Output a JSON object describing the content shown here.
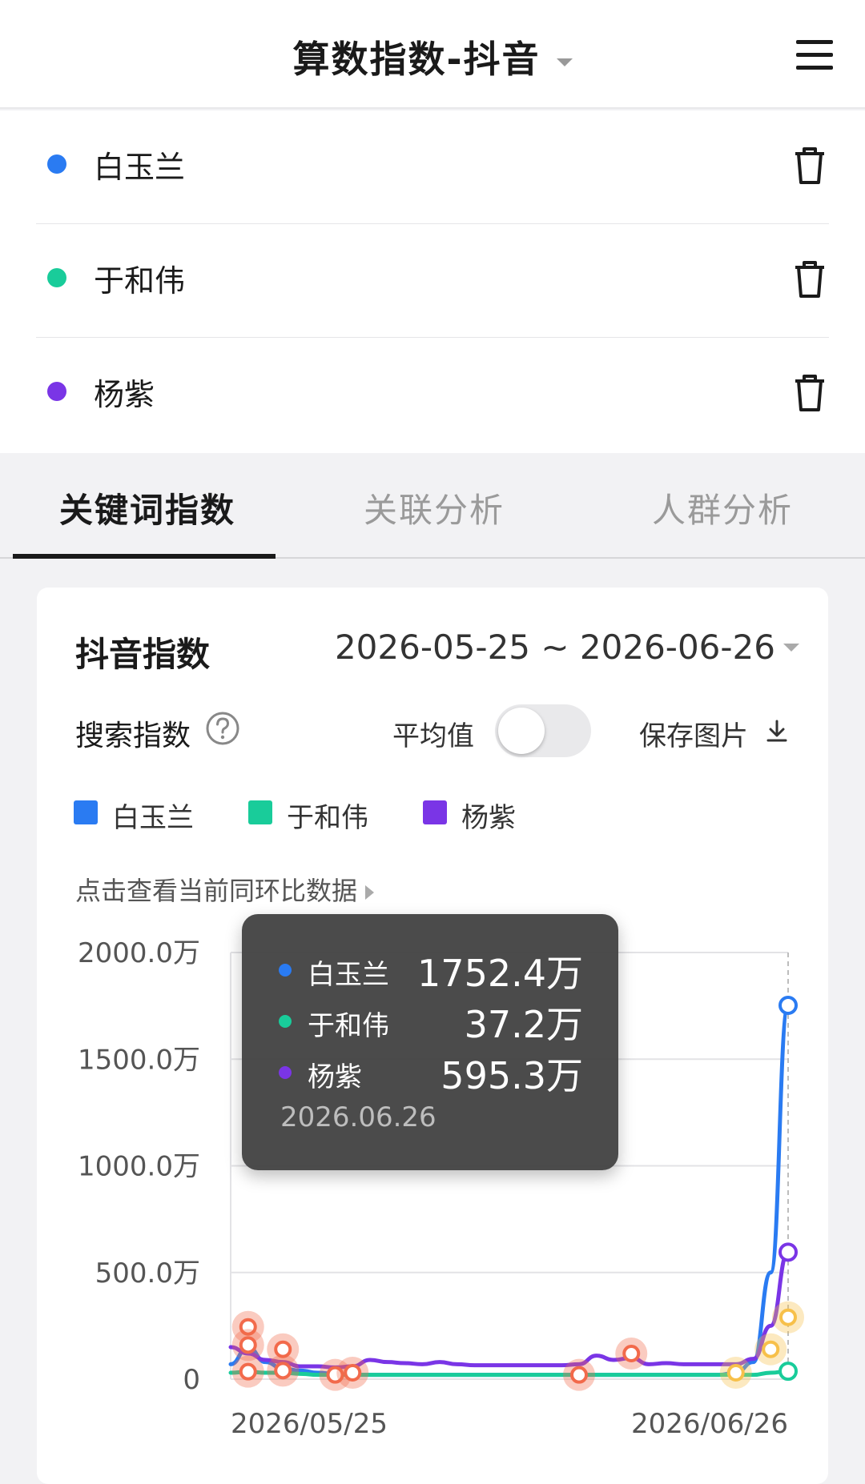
{
  "header": {
    "title": "算数指数-抖音"
  },
  "keywords": [
    {
      "label": "白玉兰",
      "color": "#2a7bf2"
    },
    {
      "label": "于和伟",
      "color": "#19cc9a"
    },
    {
      "label": "杨紫",
      "color": "#7a35e6"
    }
  ],
  "tabs": [
    {
      "label": "关键词指数",
      "active": true
    },
    {
      "label": "关联分析",
      "active": false
    },
    {
      "label": "人群分析",
      "active": false
    }
  ],
  "card": {
    "title": "抖音指数",
    "date_range": "2026-05-25 ~ 2026-06-26",
    "metric_label": "搜索指数",
    "average_label": "平均值",
    "average_enabled": false,
    "save_label": "保存图片",
    "compare_link": "点击查看当前同环比数据"
  },
  "tooltip": {
    "date": "2026.06.26",
    "items": [
      {
        "name": "白玉兰",
        "value": "1752.4万",
        "color": "#2a7bf2"
      },
      {
        "name": "于和伟",
        "value": "37.2万",
        "color": "#19cc9a"
      },
      {
        "name": "杨紫",
        "value": "595.3万",
        "color": "#7a35e6"
      }
    ]
  },
  "chart_data": {
    "type": "line",
    "x_tick_labels": [
      "2026/05/25",
      "2026/06/26"
    ],
    "y_tick_labels": [
      "0",
      "500.0万",
      "1000.0万",
      "1500.0万",
      "2000.0万"
    ],
    "ylim": [
      0,
      2000
    ],
    "y_unit": "万",
    "grid": true,
    "legend_position": "top-left",
    "x_points": 33,
    "series": [
      {
        "name": "白玉兰",
        "color": "#2a7bf2",
        "values": [
          70,
          150,
          80,
          50,
          40,
          30,
          25,
          20,
          20,
          20,
          20,
          20,
          20,
          20,
          20,
          20,
          20,
          20,
          20,
          20,
          20,
          20,
          20,
          20,
          20,
          20,
          20,
          20,
          20,
          30,
          80,
          500,
          1752.4
        ]
      },
      {
        "name": "于和伟",
        "color": "#19cc9a",
        "values": [
          30,
          35,
          30,
          30,
          25,
          20,
          20,
          20,
          20,
          20,
          20,
          20,
          20,
          20,
          20,
          20,
          20,
          20,
          20,
          20,
          20,
          20,
          20,
          20,
          20,
          20,
          20,
          20,
          20,
          20,
          20,
          30,
          37.2
        ]
      },
      {
        "name": "杨紫",
        "color": "#7a35e6",
        "values": [
          150,
          120,
          90,
          80,
          60,
          60,
          55,
          60,
          90,
          80,
          75,
          70,
          80,
          70,
          65,
          65,
          65,
          65,
          65,
          65,
          70,
          110,
          90,
          100,
          70,
          75,
          70,
          70,
          70,
          70,
          95,
          250,
          595.3
        ]
      }
    ],
    "markers": [
      {
        "index": 1,
        "value": 245,
        "color": "#f26a4b"
      },
      {
        "index": 1,
        "value": 160,
        "color": "#f26a4b"
      },
      {
        "index": 1,
        "value": 35,
        "color": "#f26a4b"
      },
      {
        "index": 3,
        "value": 140,
        "color": "#f26a4b"
      },
      {
        "index": 3,
        "value": 40,
        "color": "#f26a4b"
      },
      {
        "index": 6,
        "value": 20,
        "color": "#f26a4b"
      },
      {
        "index": 7,
        "value": 30,
        "color": "#f26a4b"
      },
      {
        "index": 20,
        "value": 20,
        "color": "#f26a4b"
      },
      {
        "index": 23,
        "value": 120,
        "color": "#f26a4b"
      },
      {
        "index": 29,
        "value": 30,
        "color": "#f7c04a"
      },
      {
        "index": 31,
        "value": 140,
        "color": "#f7c04a"
      },
      {
        "index": 32,
        "value": 290,
        "color": "#f7c04a"
      }
    ]
  }
}
